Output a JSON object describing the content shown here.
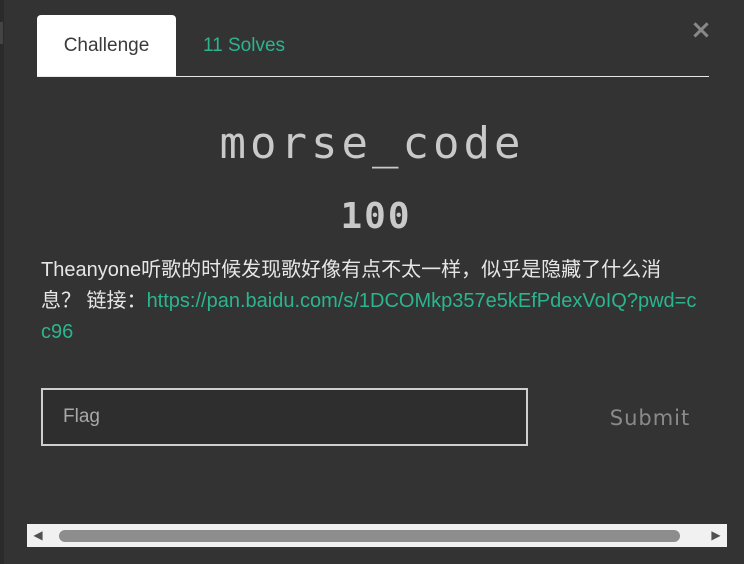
{
  "tabs": {
    "challenge_label": "Challenge",
    "solves_label": "11 Solves"
  },
  "close_icon": "close-icon",
  "challenge": {
    "name": "morse_code",
    "points": "100",
    "description_text": "Theanyone听歌的时候发现歌好像有点不太一样，似乎是隐藏了什么消息？ 链接：",
    "link_text": "https://pan.baidu.com/s/1DCOMkp357e5kEfPdexVoIQ?pwd=cc96"
  },
  "form": {
    "flag_placeholder": "Flag",
    "flag_value": "",
    "submit_label": "Submit"
  },
  "scrollbar": {
    "left_arrow": "◀",
    "right_arrow": "▶"
  },
  "colors": {
    "background": "#333333",
    "accent": "#2bb58f",
    "text": "#e6e6e6"
  }
}
